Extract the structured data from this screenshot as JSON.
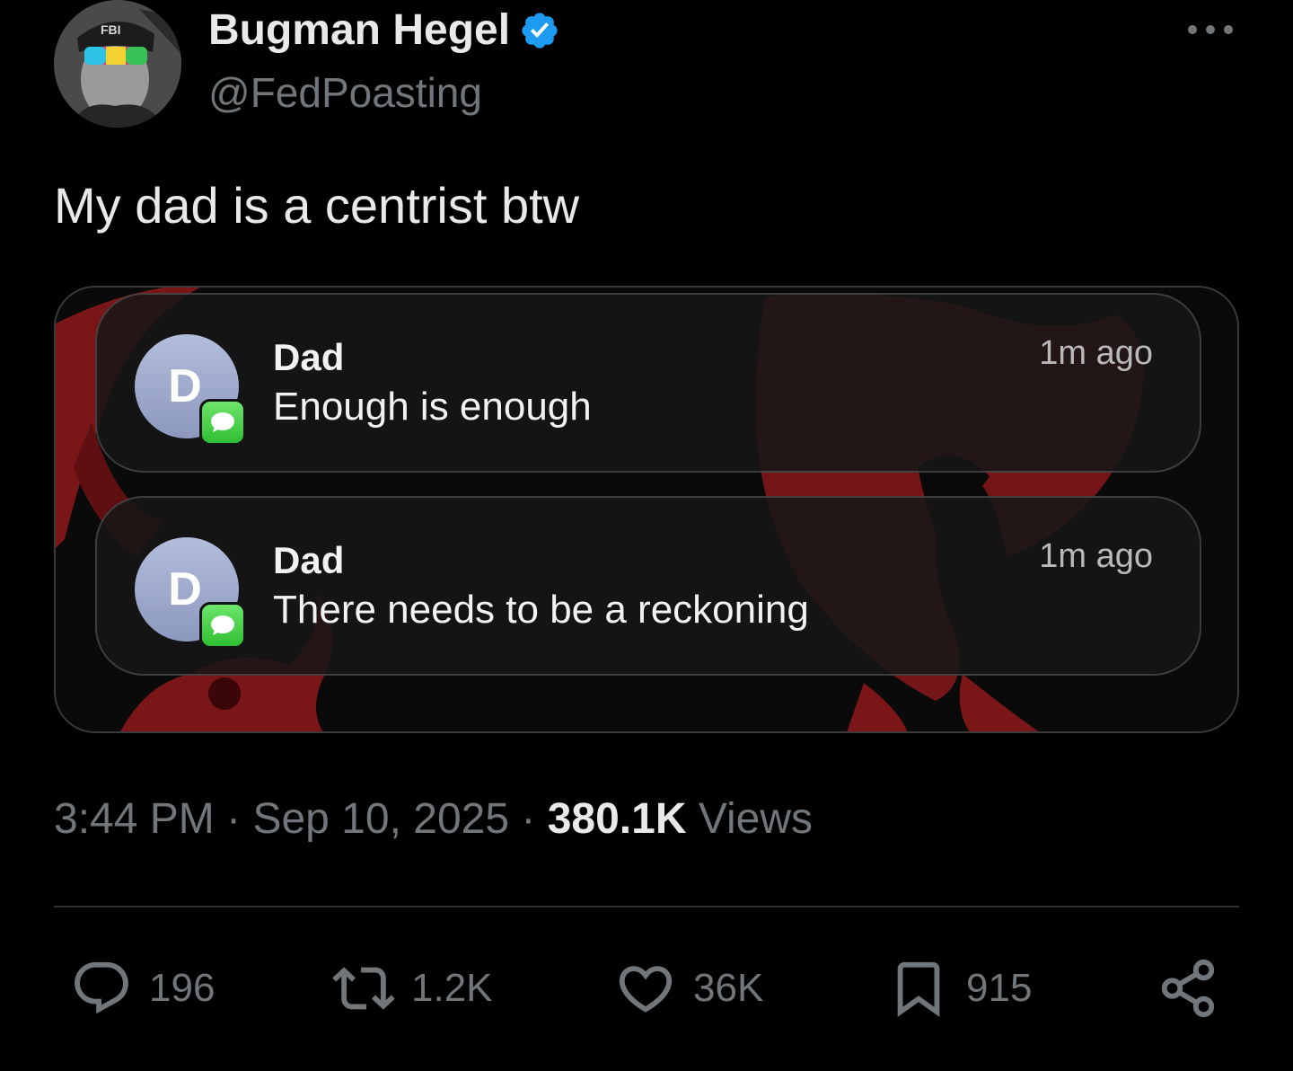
{
  "author": {
    "display_name": "Bugman Hegel",
    "handle": "@FedPoasting",
    "verified": true,
    "avatar_cap_text": "FBI",
    "avatar_icon": "user-avatar-image",
    "verified_icon": "verified-badge-icon",
    "verified_color": "#1d9bf0"
  },
  "more_icon": "more-horizontal-icon",
  "tweet": {
    "text": "My dad is a centrist btw"
  },
  "media": {
    "notifications": [
      {
        "avatar_letter": "D",
        "sender": "Dad",
        "body": "Enough is enough",
        "time": "1m ago",
        "app_icon": "messages-app-icon"
      },
      {
        "avatar_letter": "D",
        "sender": "Dad",
        "body": "There needs to be a reckoning",
        "time": "1m ago",
        "app_icon": "messages-app-icon"
      }
    ],
    "accent_color": "#7a1618"
  },
  "meta": {
    "time": "3:44 PM",
    "separator": "·",
    "date": "Sep 10, 2025",
    "views_count": "380.1K",
    "views_label": "Views"
  },
  "actions": {
    "reply": {
      "icon": "reply-icon",
      "count": "196"
    },
    "retweet": {
      "icon": "retweet-icon",
      "count": "1.2K"
    },
    "like": {
      "icon": "heart-icon",
      "count": "36K"
    },
    "bookmark": {
      "icon": "bookmark-icon",
      "count": "915"
    },
    "share": {
      "icon": "share-icon"
    }
  },
  "colors": {
    "background": "#000000",
    "primary_text": "#e7e9ea",
    "secondary_text": "#71767b",
    "divider": "#2f3336"
  }
}
